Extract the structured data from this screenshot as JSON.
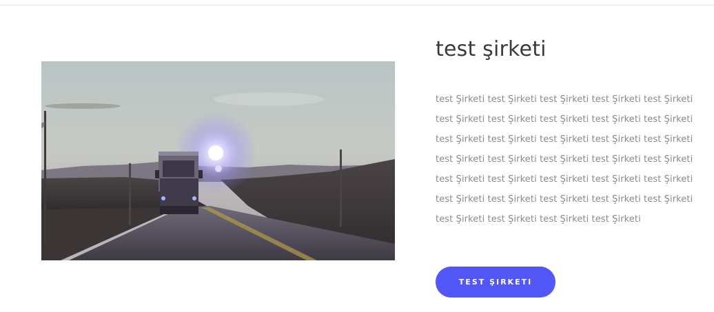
{
  "section": {
    "title": "test şirketi",
    "body": "test Şirketi test Şirketi test Şirketi test Şirketi test Şirketi test Şirketi test Şirketi test Şirketi test Şirketi test Şirketi test Şirketi test Şirketi test Şirketi test Şirketi test Şirketi test Şirketi test Şirketi test Şirketi test Şirketi test Şirketi test Şirketi test Şirketi test Şirketi test Şirketi test Şirketi test Şirketi test Şirketi test Şirketi test Şirketi test Şirketi test Şirketi test Şirketi test Şirketi test Şirketi",
    "button_label": "TEST ŞIRKETI",
    "image_alt_subject": "truck-on-road-at-sunset"
  },
  "colors": {
    "accent": "#5357f7",
    "title": "#3a3a3a",
    "body_text": "#8a8a8a"
  }
}
